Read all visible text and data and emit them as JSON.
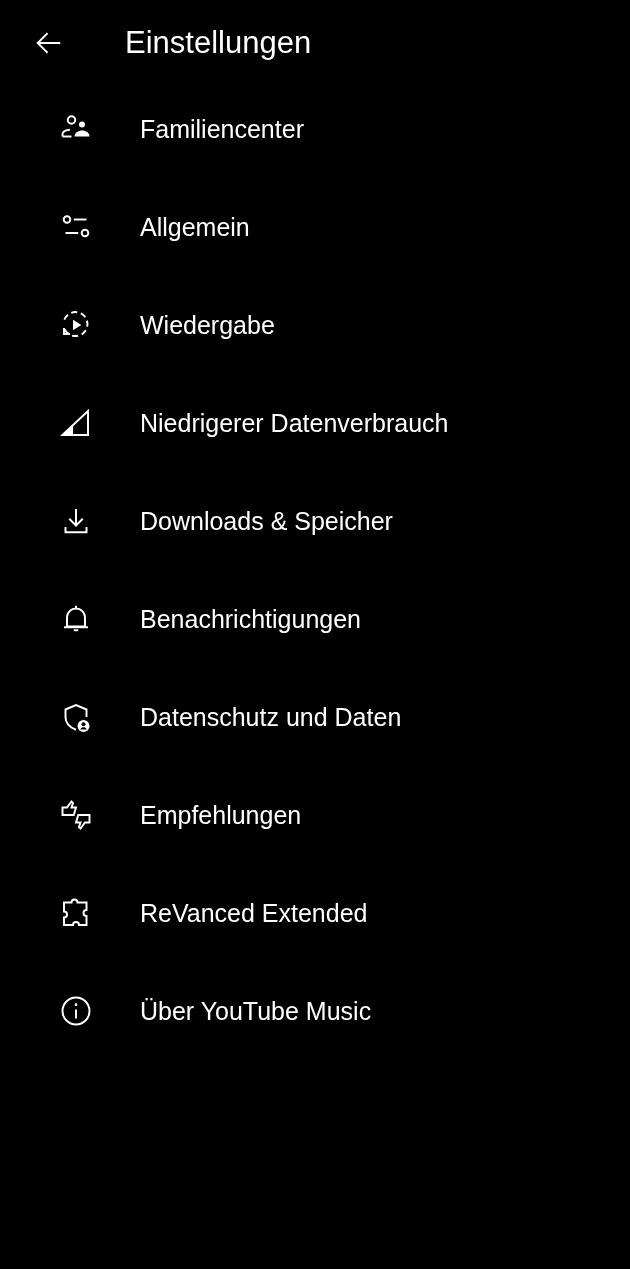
{
  "header": {
    "title": "Einstellungen"
  },
  "items": [
    {
      "label": "Familiencenter"
    },
    {
      "label": "Allgemein"
    },
    {
      "label": "Wiedergabe"
    },
    {
      "label": "Niedrigerer Datenverbrauch"
    },
    {
      "label": "Downloads & Speicher"
    },
    {
      "label": "Benachrichtigungen"
    },
    {
      "label": "Datenschutz und Daten"
    },
    {
      "label": "Empfehlungen"
    },
    {
      "label": "ReVanced Extended"
    },
    {
      "label": "Über YouTube Music"
    }
  ]
}
